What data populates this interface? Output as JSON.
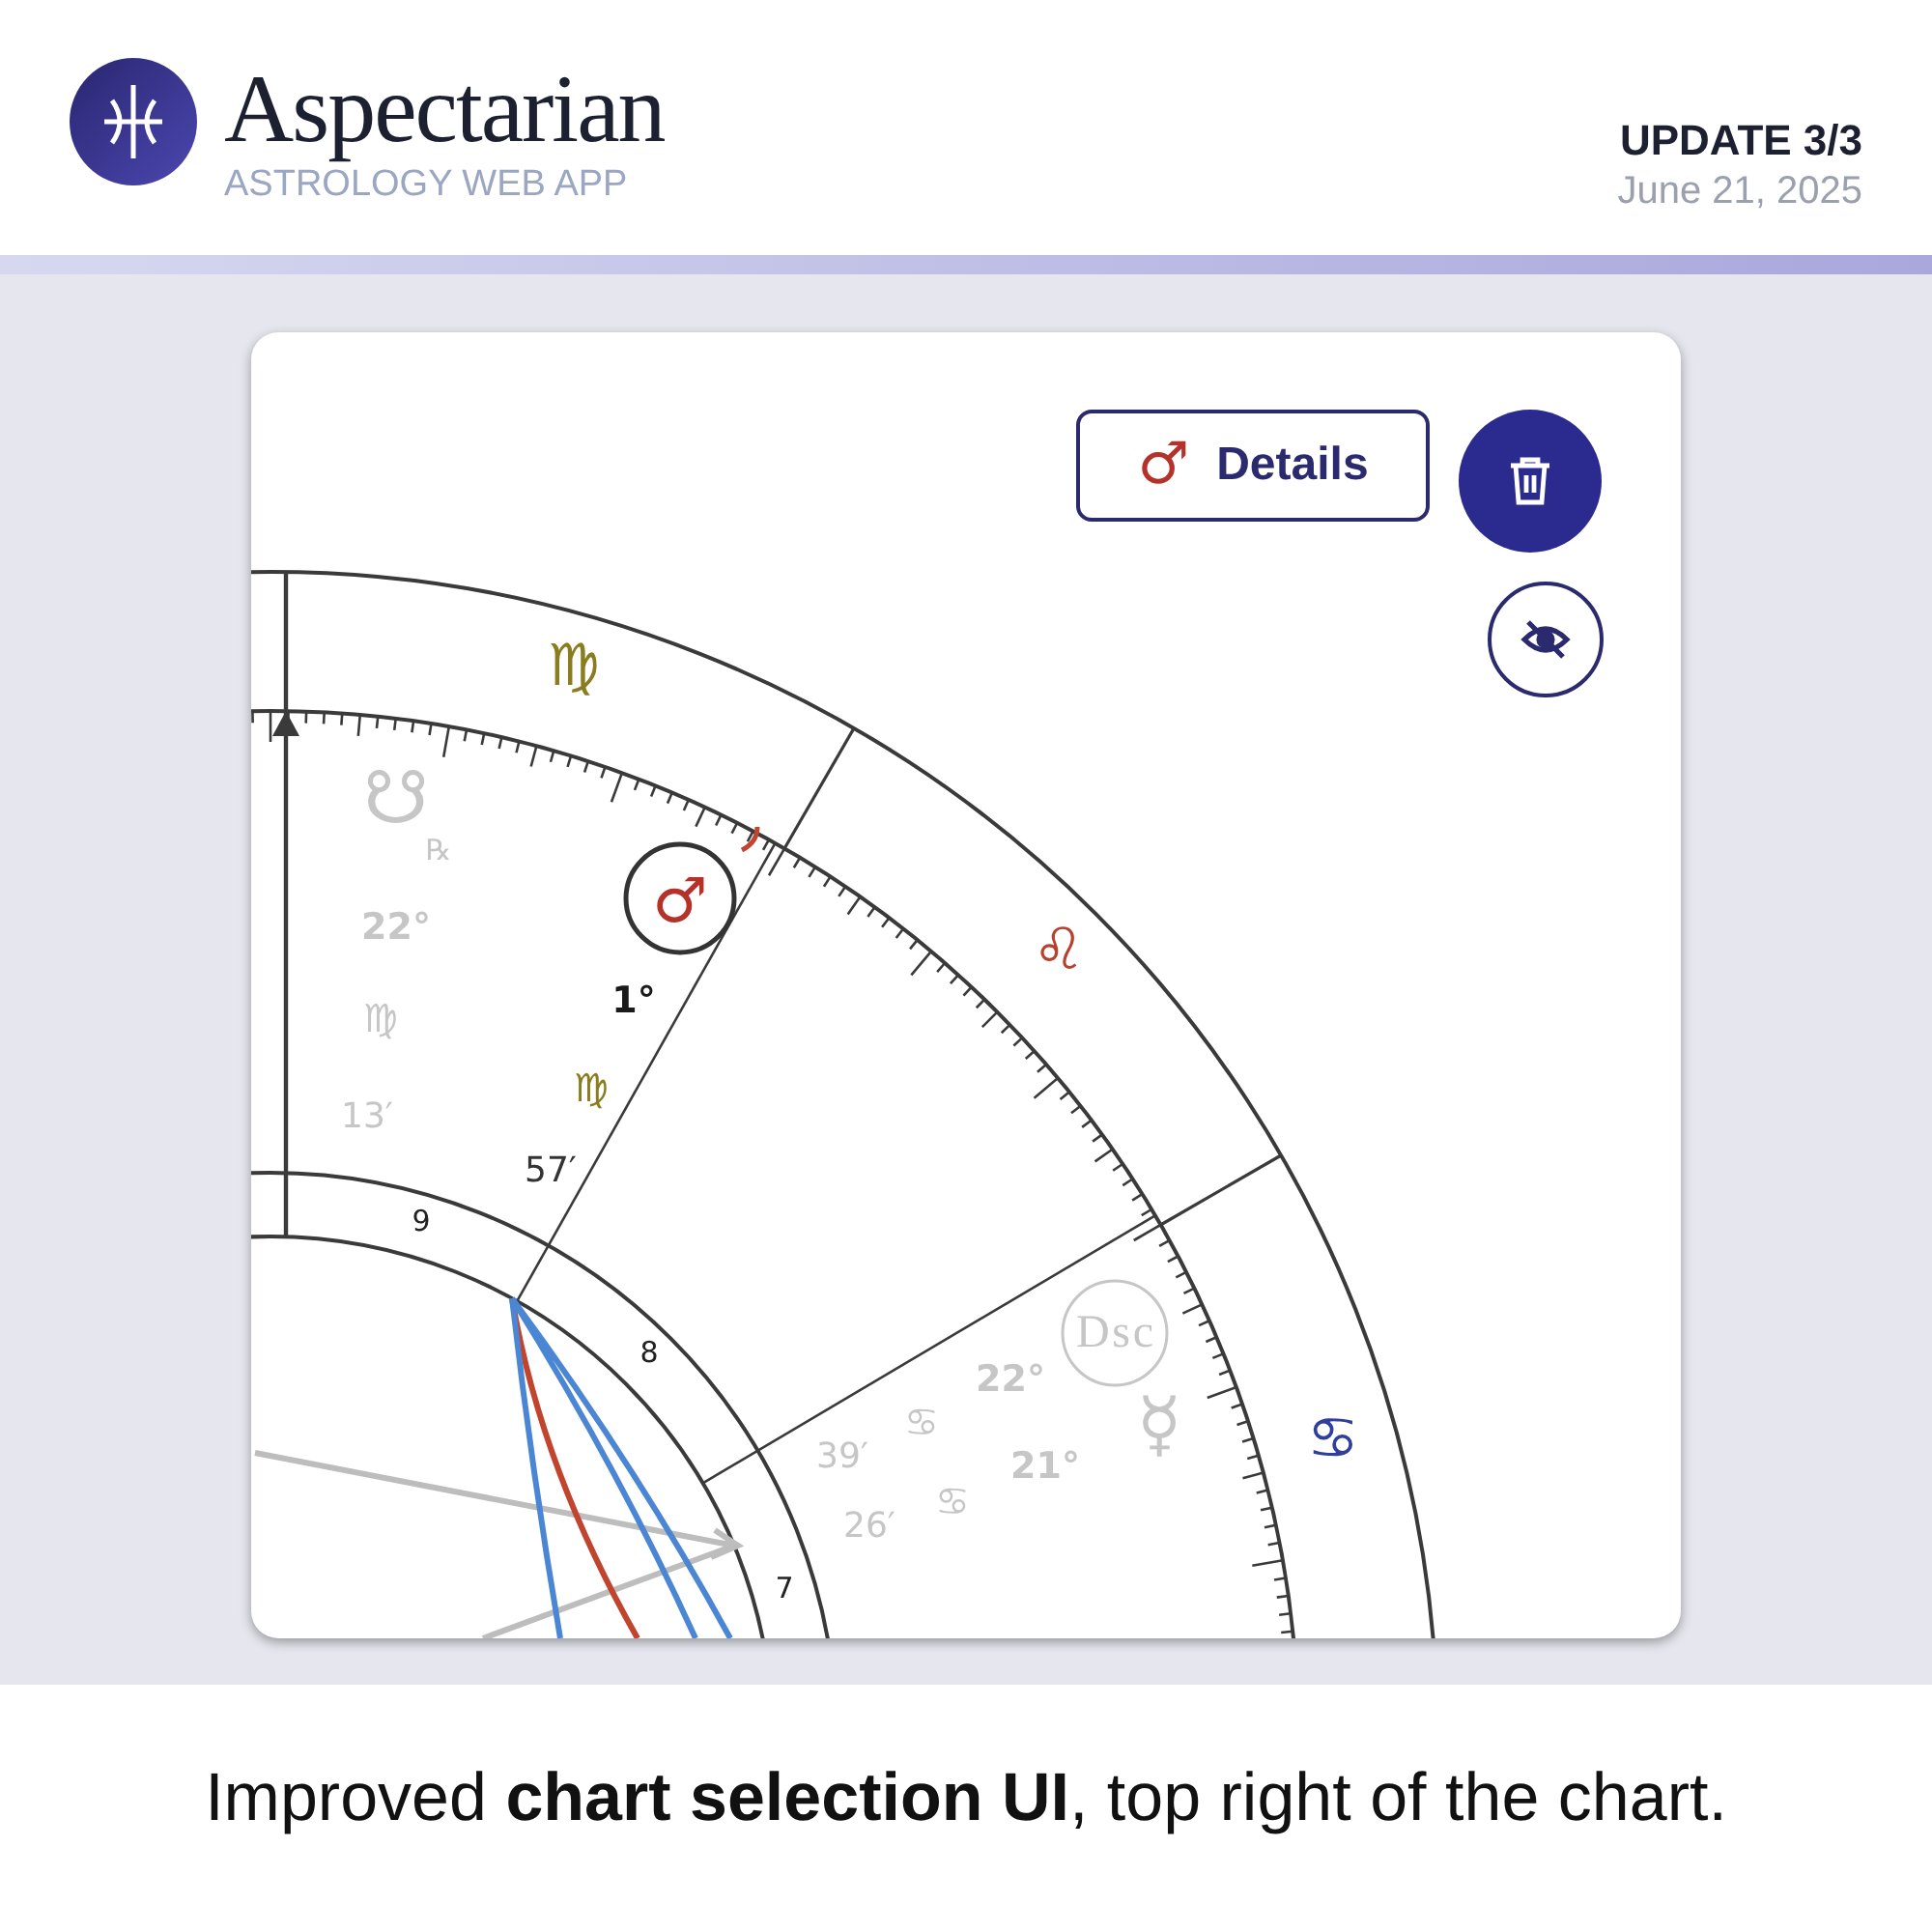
{
  "header": {
    "title": "Aspectarian",
    "subtitle": "ASTROLOGY WEB APP",
    "update": "UPDATE 3/3",
    "date": "June 21, 2025"
  },
  "chart": {
    "details_button": {
      "symbol": "♂",
      "label": "Details"
    },
    "signs": [
      {
        "glyph": "♍",
        "color": "#8a7d1e"
      },
      {
        "glyph": "♌",
        "color": "#b5412e"
      },
      {
        "glyph": "♋",
        "color": "#2f3f9e"
      }
    ],
    "house_numbers": [
      "9",
      "8",
      "7"
    ],
    "points": [
      {
        "glyph": "☋",
        "retrograde": "℞",
        "degree": "22°",
        "sign": "♍",
        "minutes": "13′",
        "selected": false,
        "dimmed": true
      },
      {
        "glyph": "♂",
        "degree": "1°",
        "sign": "♍",
        "minutes": "57′",
        "selected": true,
        "dimmed": false
      },
      {
        "glyph": "Dsc",
        "degree": "22°",
        "sign": "♋",
        "minutes": "39′",
        "selected": false,
        "dimmed": true
      },
      {
        "glyph": "☿",
        "degree": "21°",
        "sign": "♋",
        "minutes": "26′",
        "selected": false,
        "dimmed": true
      }
    ]
  },
  "caption": "Improved **chart selection UI**, top right of the chart."
}
